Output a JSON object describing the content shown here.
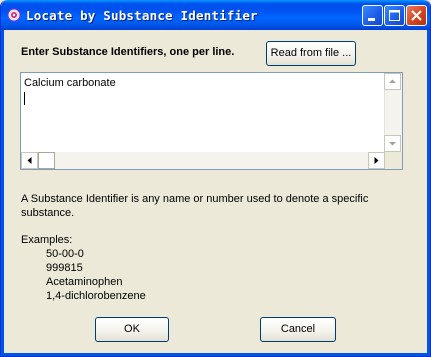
{
  "window": {
    "title": "Locate by Substance Identifier",
    "controls": [
      "minimize-icon",
      "maximize-icon",
      "close-icon"
    ]
  },
  "prompt": {
    "label": "Enter Substance Identifiers, one per line.",
    "read_button": "Read from file ..."
  },
  "text_area": {
    "value": "Calcium carbonate"
  },
  "info": {
    "description": "A Substance Identifier is any name or number used to denote a specific substance.",
    "examples_label": "Examples:",
    "examples": [
      "50-00-0",
      "999815",
      "Acetaminophen",
      "1,4-dichlorobenzene"
    ]
  },
  "buttons": {
    "ok": "OK",
    "cancel": "Cancel"
  },
  "colors": {
    "title_bar": "#0055e5",
    "close_button": "#d4451f",
    "dialog_bg": "#ece9d8"
  }
}
